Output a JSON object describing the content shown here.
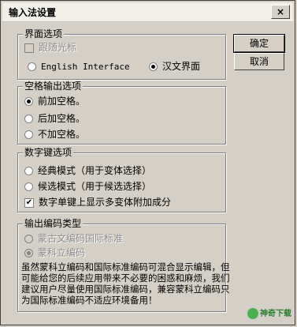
{
  "window": {
    "title": "输入法设置",
    "close_glyph": "×"
  },
  "buttons": {
    "ok": "确定",
    "cancel": "取消"
  },
  "interface_group": {
    "label": "界面选项",
    "follow_cursor": {
      "label": "跟随光标",
      "checked": false,
      "disabled": true
    },
    "options": [
      {
        "label": "English Interface",
        "selected": false
      },
      {
        "label": "汉文界面",
        "selected": true
      }
    ]
  },
  "space_group": {
    "label": "空格输出选项",
    "options": [
      {
        "label": "前加空格。",
        "selected": true
      },
      {
        "label": "后加空格。",
        "selected": false
      },
      {
        "label": "不加空格。",
        "selected": false
      }
    ]
  },
  "digit_group": {
    "label": "数字键选项",
    "options": [
      {
        "label": "经典模式（用于变体选择）",
        "selected": false
      },
      {
        "label": "候选模式（用于候选选择）",
        "selected": false
      }
    ],
    "show_variants": {
      "label": "数字单键上显示多变体附加成分",
      "checked": true
    }
  },
  "encoding_group": {
    "label": "输出编码类型",
    "options": [
      {
        "label": "蒙古文编码国际标准",
        "selected": false,
        "disabled": true
      },
      {
        "label": "蒙科立编码",
        "selected": true,
        "disabled": true
      }
    ],
    "note": "虽然蒙科立编码和国际标准编码可混合显示编辑，但可能给您的后续应用带来不必要的困惑和麻烦，我们建议用户尽量使用国际标准编码，兼容蒙科立编码只为国际标准编码不适应环境备用！"
  },
  "watermark": {
    "text": "神奇下载"
  }
}
